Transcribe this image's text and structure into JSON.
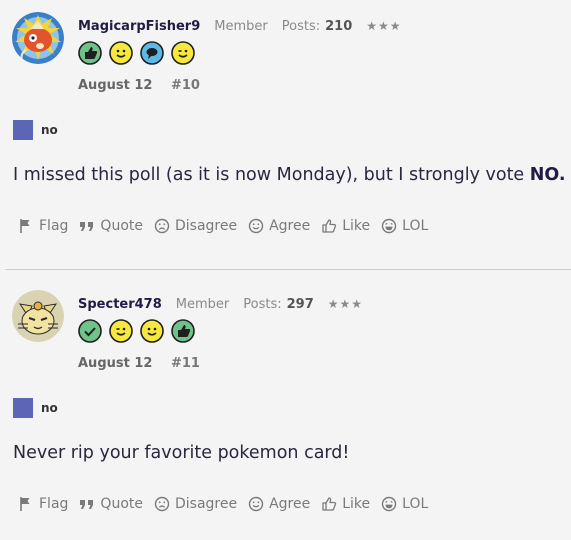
{
  "posts": [
    {
      "username": "MagicarpFisher9",
      "role": "Member",
      "posts_label": "Posts:",
      "posts_count": "210",
      "stars": "★★★",
      "date": "August 12",
      "post_number": "#10",
      "poll_choice": "no",
      "body_text": "I missed this poll (as it is now Monday), but I strongly vote ",
      "body_bold": "NO.",
      "badges": [
        "thumbs-up-icon",
        "smile-icon",
        "speech-bubble-icon",
        "wink-icon"
      ]
    },
    {
      "username": "Specter478",
      "role": "Member",
      "posts_label": "Posts:",
      "posts_count": "297",
      "stars": "★★★",
      "date": "August 12",
      "post_number": "#11",
      "poll_choice": "no",
      "body_text": "Never rip your favorite pokemon card!",
      "body_bold": "",
      "badges": [
        "checkmark-icon",
        "wink-icon",
        "smile-icon",
        "thumbs-up-icon"
      ]
    }
  ],
  "actions": {
    "flag": "Flag",
    "quote": "Quote",
    "disagree": "Disagree",
    "agree": "Agree",
    "like": "Like",
    "lol": "LOL"
  },
  "colors": {
    "poll_box": "#5b66b7",
    "username": "#231a45"
  }
}
